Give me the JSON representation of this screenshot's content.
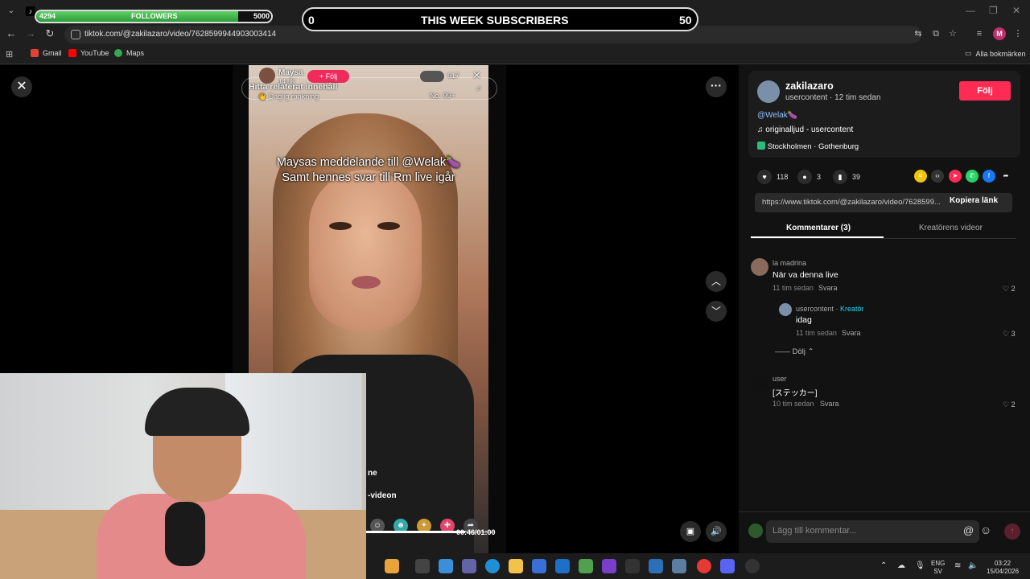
{
  "overlays": {
    "followers": {
      "count": "4294",
      "label": "FOLLOWERS",
      "goal": "5000",
      "progress": 0.8588
    },
    "subscribers": {
      "start": "0",
      "label": "THIS WEEK SUBSCRIBERS",
      "goal": "50"
    }
  },
  "browser": {
    "url": "tiktok.com/@zakilazaro/video/7628599944903003414",
    "profile_initial": "M",
    "bookmarks": [
      "Gmail",
      "YouTube",
      "Maps"
    ],
    "all_bookmarks": "Alla bokmärken"
  },
  "video": {
    "creator_name": "Maysa",
    "likes_count": "14.8K",
    "follow_label": "+ Följ",
    "related_search": "Hitta relaterat innehåll",
    "ranking": "Daglig rankning",
    "viewers": "617",
    "rank": "No. 99+",
    "caption_line1": "Maysas meddelande till @Welak🍆",
    "caption_line2": "Samt hennes svar till Rm live igår",
    "side_text_1": "ne",
    "side_text_2": "-videon",
    "time": "00:46/01:00",
    "progress": 0.7667
  },
  "author": {
    "username": "zakilazaro",
    "meta": "usercontent · 12 tim sedan",
    "follow": "Följ",
    "mention": "@Welak🍆",
    "sound": "originalljud - usercontent",
    "location": "Stockholmen · Gothenburg"
  },
  "stats": {
    "likes": "118",
    "comments": "3",
    "saves": "39"
  },
  "share": {
    "link": "https://www.tiktok.com/@zakilazaro/video/7628599...",
    "copy": "Kopiera länk"
  },
  "tabs": {
    "comments": "Kommentarer (3)",
    "creator_videos": "Kreatörens videor"
  },
  "comments": [
    {
      "user": "la madrina",
      "text": "När va denna live",
      "time": "11 tim sedan",
      "reply": "Svara",
      "likes": "2"
    },
    {
      "user": "usercontent",
      "badge": "Kreatör",
      "text": "idag",
      "time": "11 tim sedan",
      "reply": "Svara",
      "likes": "3"
    },
    {
      "user": "user",
      "text": "[ステッカー]",
      "time": "10 tim sedan",
      "reply": "Svara",
      "likes": "2"
    }
  ],
  "hide_replies": "Dölj",
  "comment_input": {
    "placeholder": "Lägg till kommentar..."
  },
  "taskbar": {
    "lang": "ENG",
    "lang2": "SV",
    "time": "03:22",
    "date": "15/04/2026"
  },
  "colors": {
    "accent": "#fe2c55",
    "follow_bar": "#3fb548"
  }
}
